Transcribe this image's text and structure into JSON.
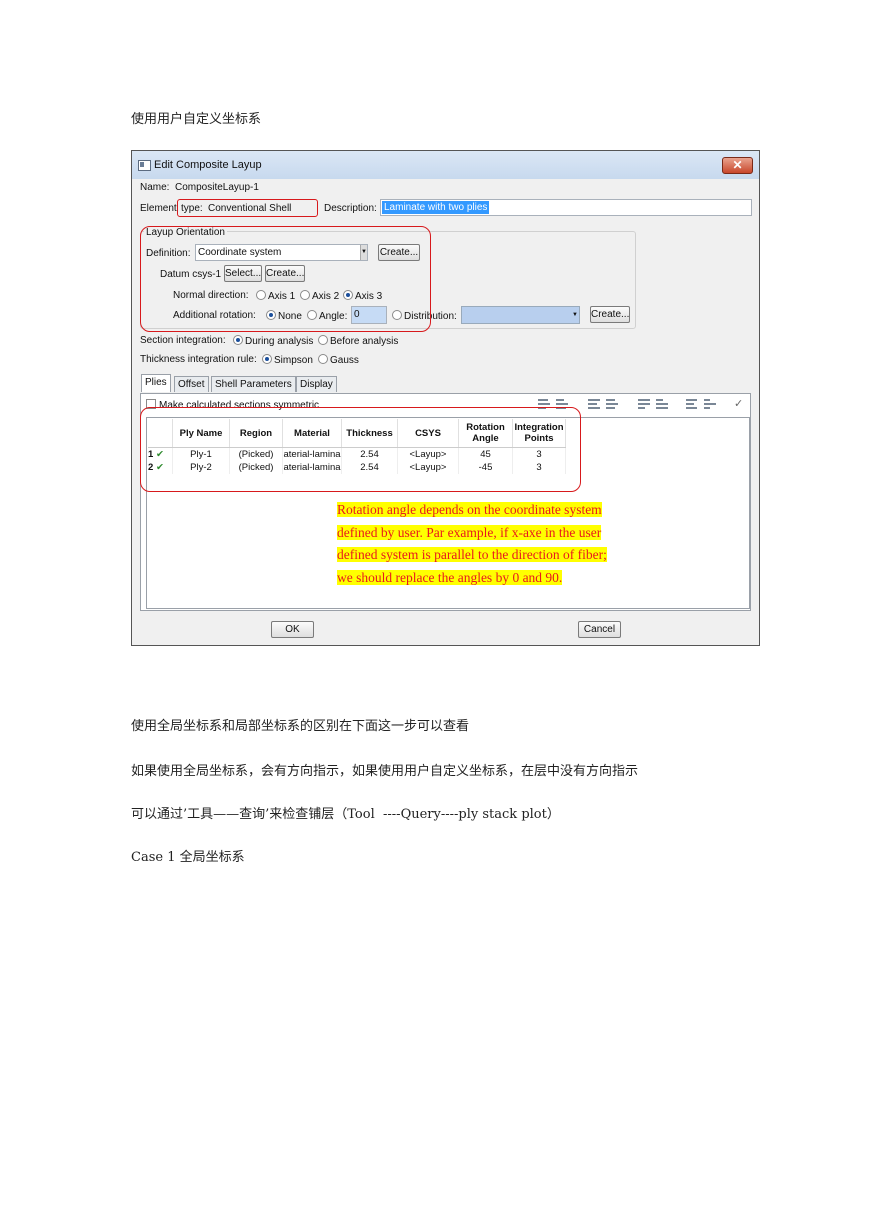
{
  "doc": {
    "heading": "使用用户自定义坐标系",
    "line1": "使用全局坐标系和局部坐标系的区别在下面这一步可以查看",
    "line2": "如果使用全局坐标系，会有方向指示，如果使用用户自定义坐标系，在层中没有方向指示",
    "line3": "可以通过’工具——查询’来检查铺层（Tool  ----Query----ply stack plot）",
    "line4": "Case 1 全局坐标系"
  },
  "dialog": {
    "title": "Edit Composite Layup",
    "close_label": "✕",
    "name_label": "Name:",
    "name_value": "CompositeLayup-1",
    "element_label": "Element",
    "element_type_label": "type:",
    "element_type_value": "Conventional Shell",
    "description_label": "Description:",
    "description_value": "Laminate with two plies",
    "orientation": {
      "group_title": "Layup Orientation",
      "definition_label": "Definition:",
      "definition_value": "Coordinate system",
      "create_label": "Create...",
      "datum_label": "Datum csys-1",
      "select_label": "Select...",
      "normal_label": "Normal direction:",
      "axis1": "Axis 1",
      "axis2": "Axis 2",
      "axis3": "Axis 3",
      "additional_label": "Additional rotation:",
      "none_label": "None",
      "angle_label": "Angle:",
      "angle_value": "0",
      "distribution_label": "Distribution:"
    },
    "section_integration_label": "Section integration:",
    "during_label": "During analysis",
    "before_label": "Before analysis",
    "thickness_rule_label": "Thickness integration rule:",
    "simpson_label": "Simpson",
    "gauss_label": "Gauss",
    "tabs": [
      "Plies",
      "Offset",
      "Shell Parameters",
      "Display"
    ],
    "symmetric_label": "Make calculated sections symmetric",
    "columns": [
      "",
      "Ply Name",
      "Region",
      "Material",
      "Thickness",
      "CSYS",
      "Rotation Angle",
      "Integration Points"
    ],
    "rows": [
      {
        "num": "1",
        "check": "✔",
        "ply": "Ply-1",
        "region": "(Picked)",
        "material": "aterial-lamina",
        "thickness": "2.54",
        "csys": "<Layup>",
        "angle": "45",
        "points": "3"
      },
      {
        "num": "2",
        "check": "✔",
        "ply": "Ply-2",
        "region": "(Picked)",
        "material": "aterial-lamina",
        "thickness": "2.54",
        "csys": "<Layup>",
        "angle": "-45",
        "points": "3"
      }
    ],
    "note_lines": [
      "Rotation angle depends on the coordinate system",
      "defined by user. Par example, if x-axe in the user",
      "defined system is parallel to the direction of fiber;",
      "we should replace the angles by 0 and 90."
    ],
    "ok_label": "OK",
    "cancel_label": "Cancel"
  }
}
